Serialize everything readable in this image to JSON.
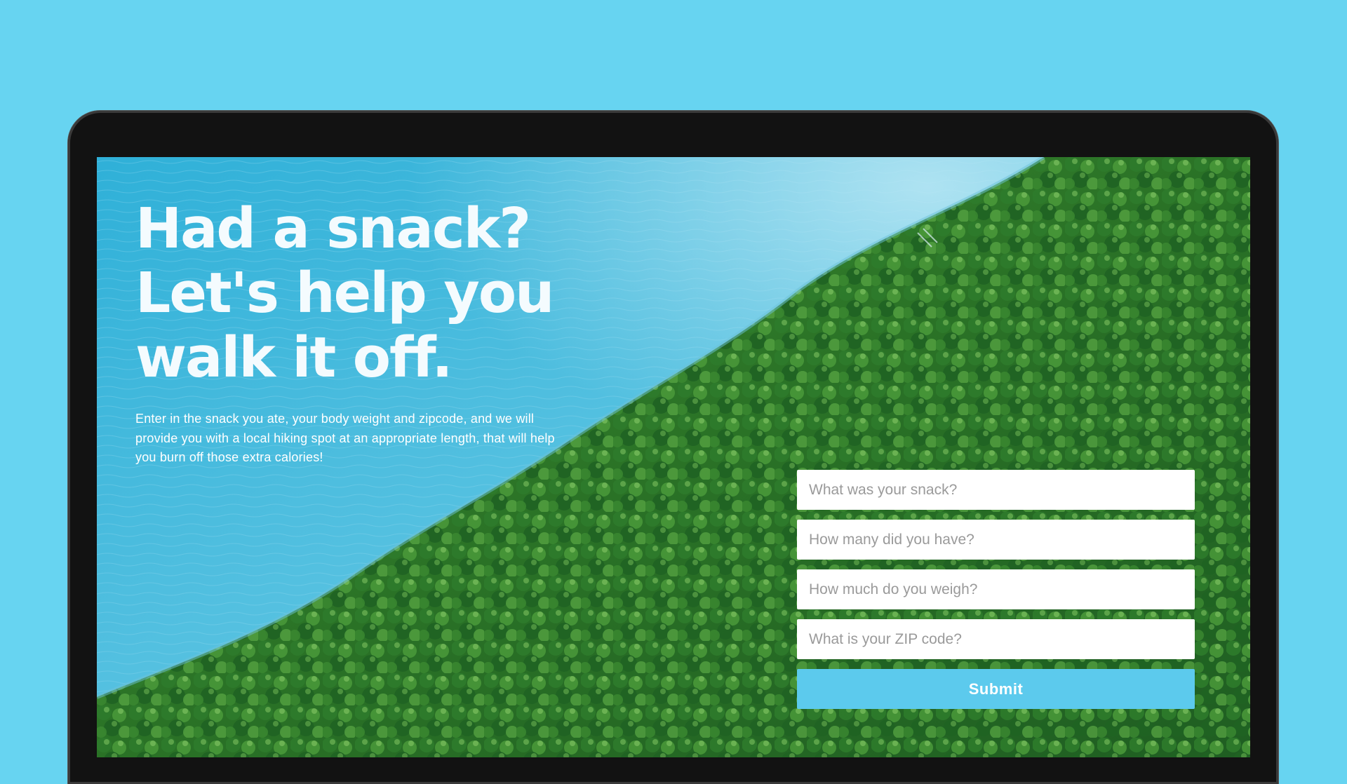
{
  "hero": {
    "headline_lines": [
      "Had a snack?",
      "Let's help you",
      "walk it off."
    ],
    "description": "Enter in the snack you ate, your body weight and zipcode, and we will provide you with a local hiking spot at an appropriate length, that will help you burn off those extra calories!"
  },
  "form": {
    "fields": [
      {
        "placeholder": "What was your snack?",
        "value": ""
      },
      {
        "placeholder": "How many did you have?",
        "value": ""
      },
      {
        "placeholder": "How much do you weigh?",
        "value": ""
      },
      {
        "placeholder": "What is your ZIP code?",
        "value": ""
      }
    ],
    "submit_label": "Submit"
  },
  "colors": {
    "backdrop": "#67d4f1",
    "water": "#38b3d6",
    "forest": "#2f7a2a",
    "button": "#5ccaed"
  }
}
